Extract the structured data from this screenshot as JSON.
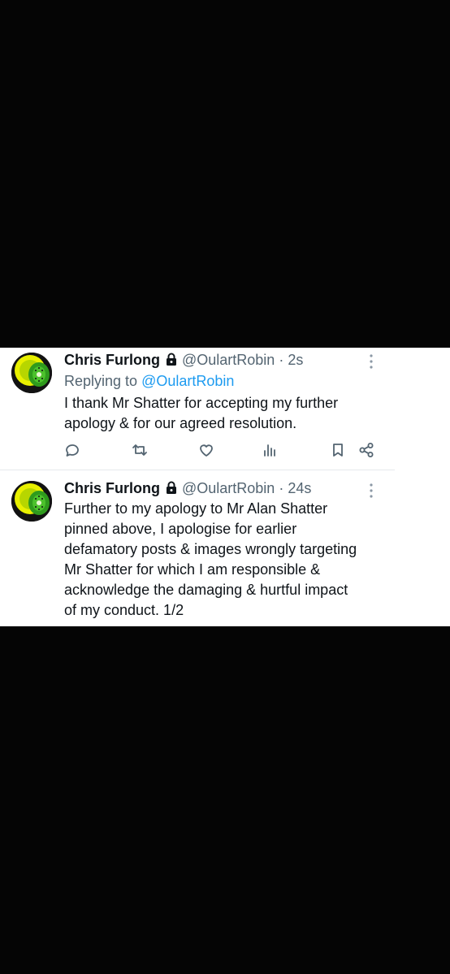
{
  "tweets": [
    {
      "author_name": "Chris Furlong",
      "locked_icon": "lock-icon",
      "handle": "@OulartRobin",
      "separator": "·",
      "time": "2s",
      "replying_prefix": "Replying to",
      "replying_to": "@OulartRobin",
      "text_lines": [
        "I thank Mr Shatter for accepting my further",
        "apology & for our agreed resolution."
      ],
      "actions": [
        "reply-icon",
        "retweet-icon",
        "like-icon",
        "views-icon",
        "bookmark-icon",
        "share-icon"
      ]
    },
    {
      "author_name": "Chris Furlong",
      "locked_icon": "lock-icon",
      "handle": "@OulartRobin",
      "separator": "·",
      "time": "24s",
      "text_lines": [
        "Further to my apology to Mr Alan Shatter",
        "pinned above, I apologise for  earlier",
        "defamatory posts & images wrongly targeting",
        "Mr Shatter for which I am responsible &",
        "acknowledge the damaging & hurtful  impact",
        "of my conduct. 1/2"
      ]
    }
  ],
  "colors": {
    "background": "#050505",
    "card": "#ffffff",
    "name": "#0f1419",
    "secondary": "#536471",
    "link": "#1d9bf0",
    "avatar_yellow": "#e8f000",
    "avatar_green": "#2f9b1d"
  }
}
